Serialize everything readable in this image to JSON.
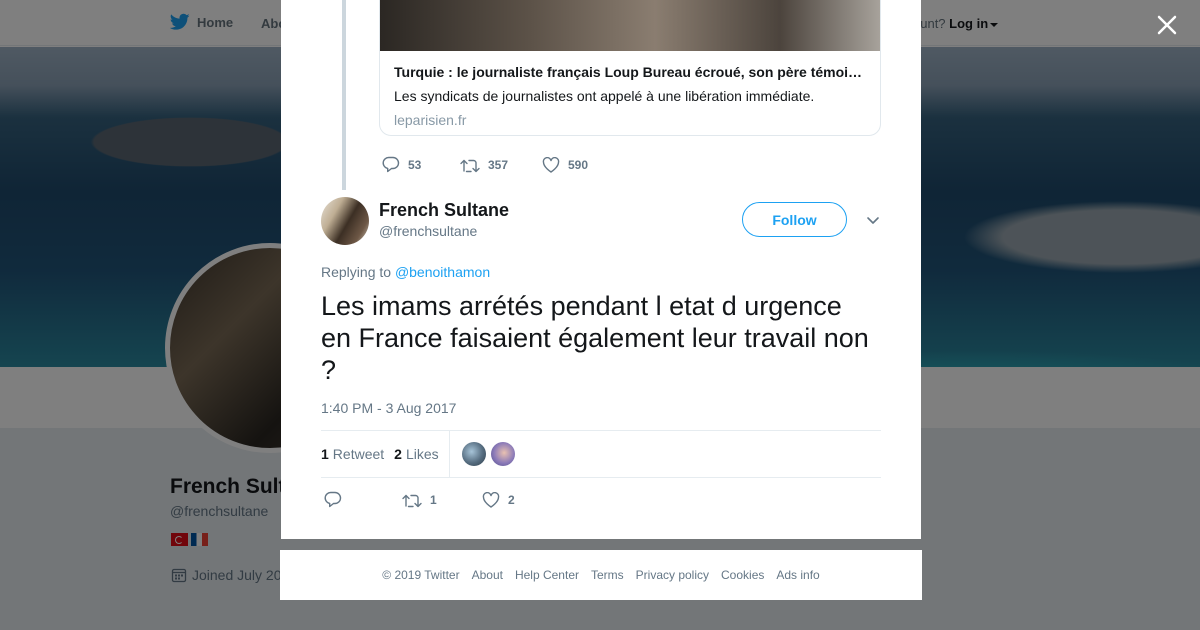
{
  "nav": {
    "home_label": "Home",
    "about_label": "Abo",
    "account_prompt": "ccount?",
    "login_label": "Log in"
  },
  "profile": {
    "name": "French Sult",
    "handle": "@frenchsultane",
    "joined": "Joined July 20"
  },
  "previous_tweet": {
    "card_title": "Turquie : le journaliste français Loup Bureau écroué, son père témoi…",
    "card_description": "Les syndicats de journalistes ont appelé à une libération immédiate.",
    "card_domain": "leparisien.fr",
    "replies": "53",
    "retweets": "357",
    "likes": "590"
  },
  "tweet": {
    "author_name": "French Sultane",
    "author_handle": "@frenchsultane",
    "follow_label": "Follow",
    "replying_prefix": "Replying to",
    "replying_to": "@benoithamon",
    "text": "Les imams arrétés pendant l etat d urgence en France faisaient également leur travail non ?",
    "timestamp": "1:40 PM - 3 Aug 2017",
    "retweet_count": "1",
    "retweet_label": "Retweet",
    "like_count": "2",
    "like_label": "Likes",
    "action_retweets": "1",
    "action_likes": "2"
  },
  "footer": {
    "copyright": "© 2019 Twitter",
    "links": [
      "About",
      "Help Center",
      "Terms",
      "Privacy policy",
      "Cookies",
      "Ads info"
    ]
  },
  "colors": {
    "twitter_blue": "#1da1f2",
    "text_primary": "#14171a",
    "text_secondary": "#657786"
  }
}
